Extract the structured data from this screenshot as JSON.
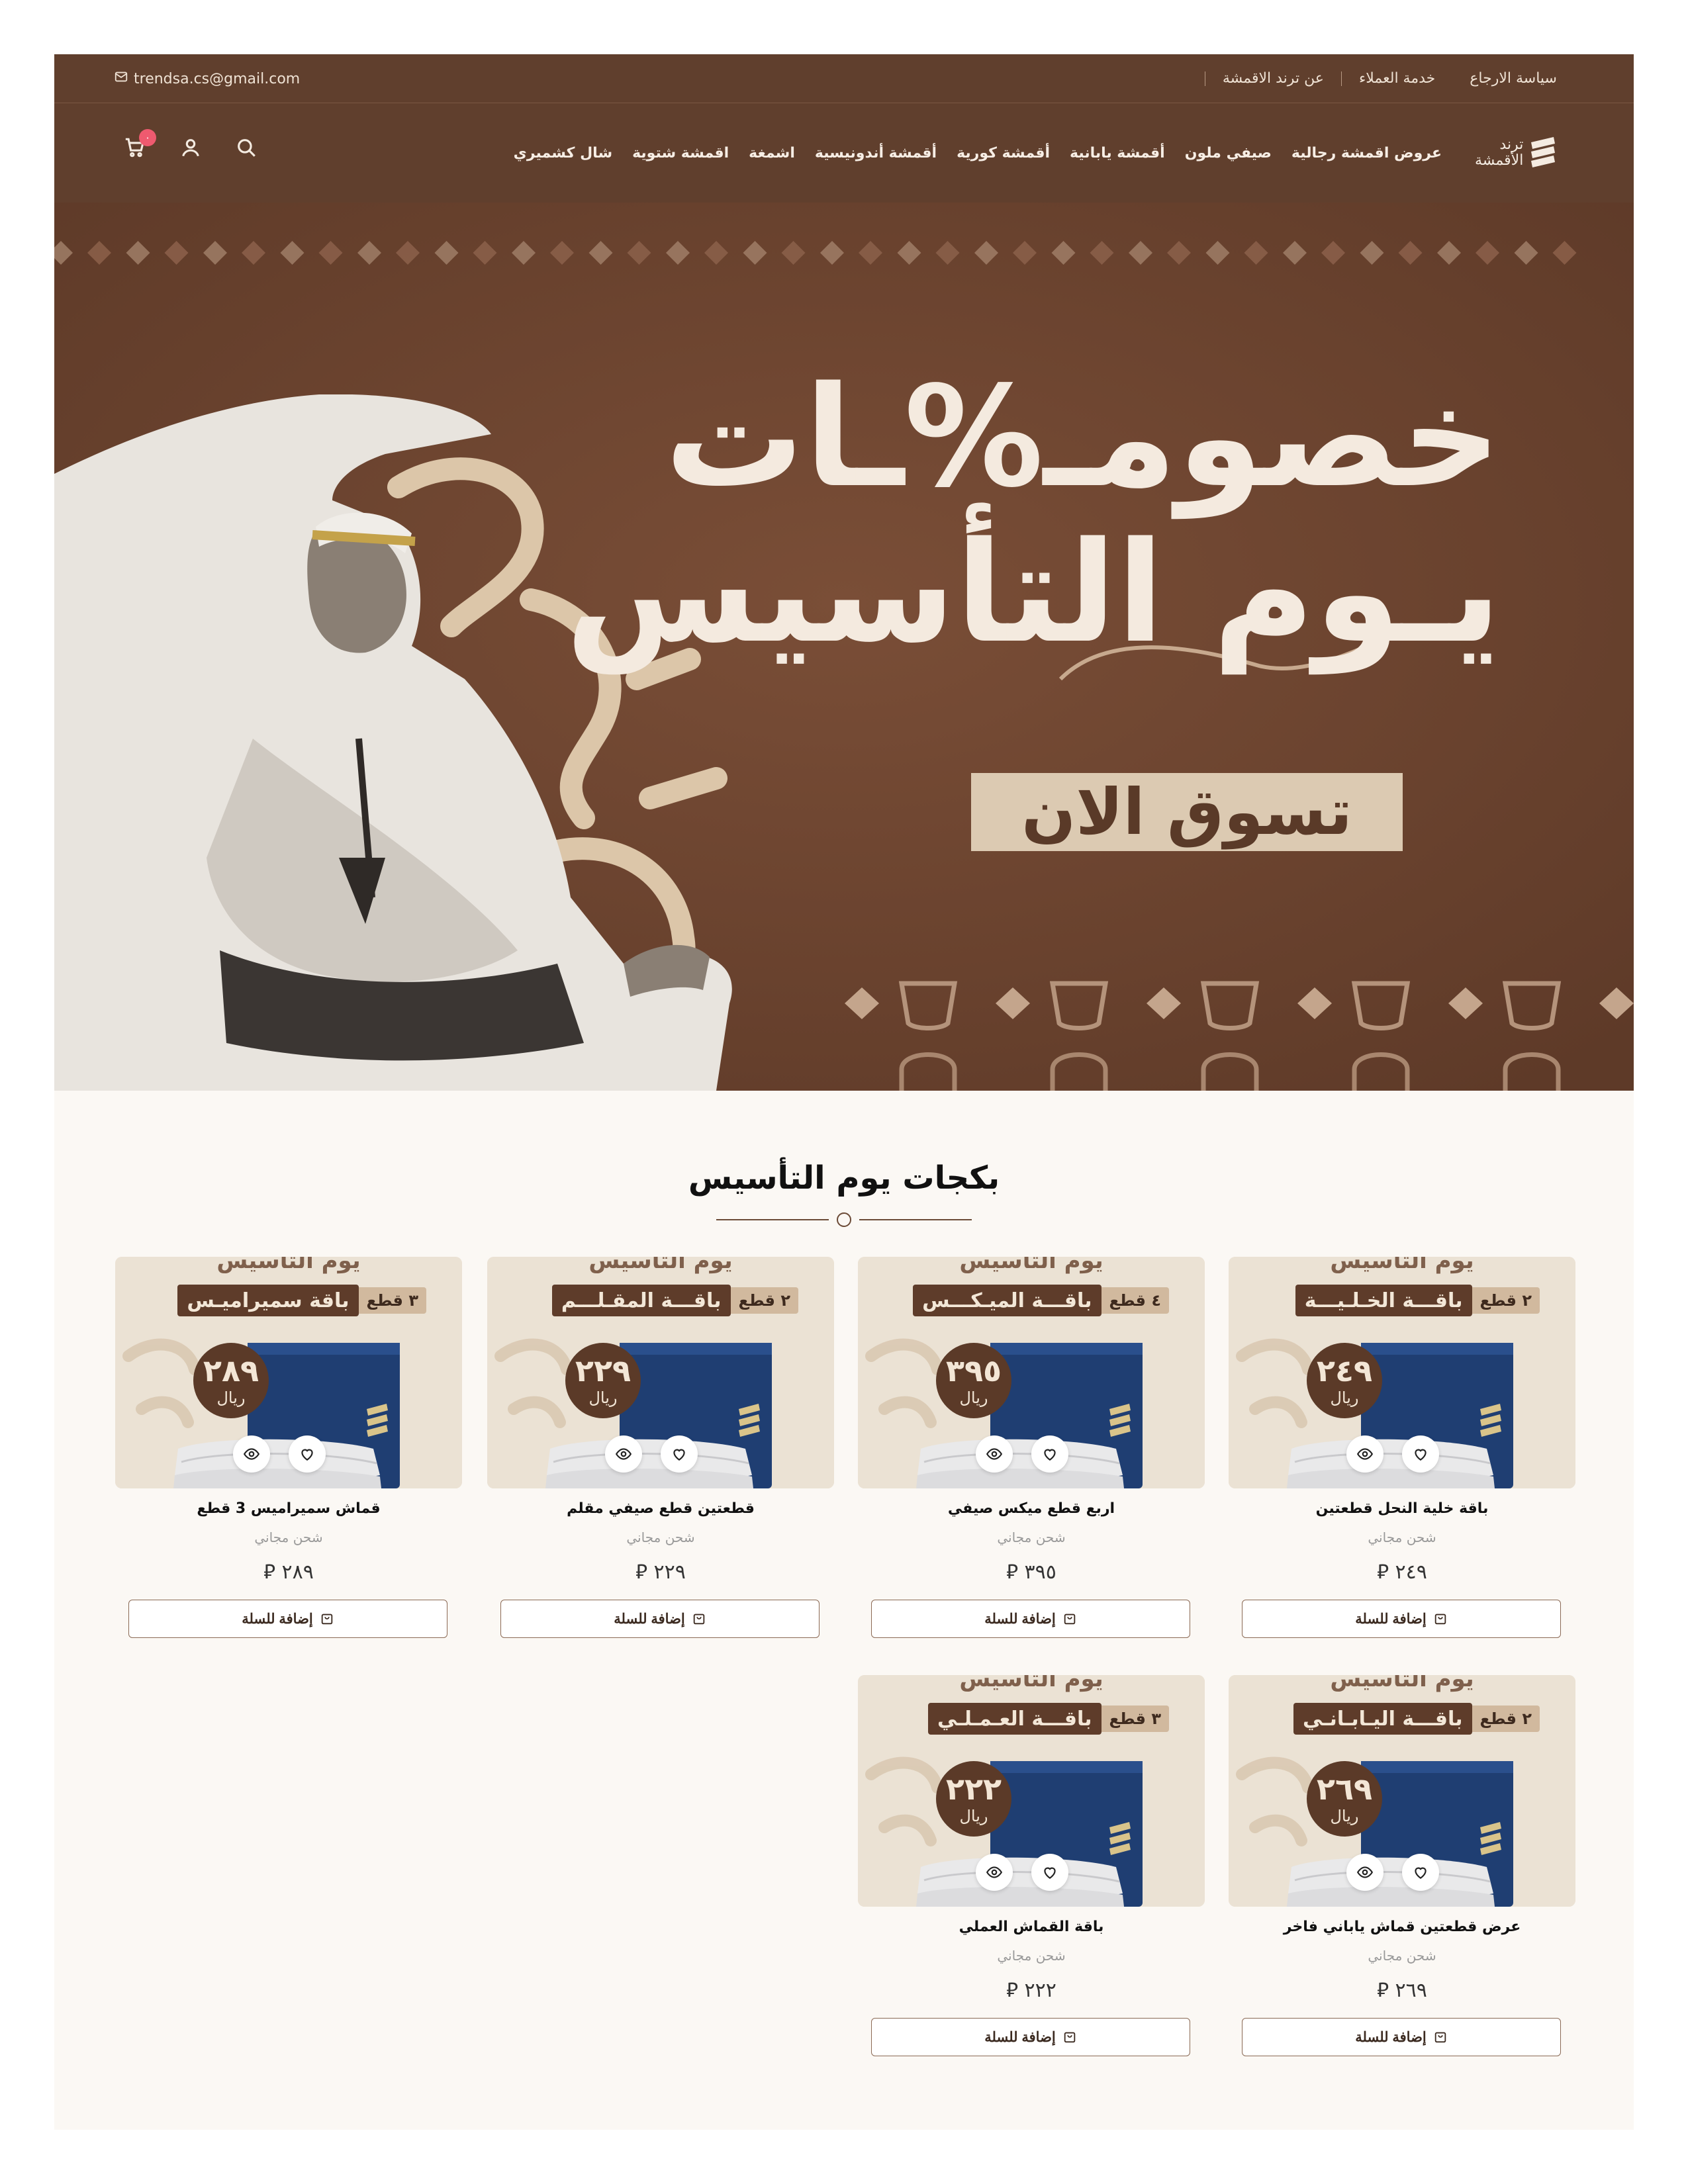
{
  "topbar": {
    "links": [
      "عن ترند الاقمشة",
      "خدمة العملاء",
      "سياسة الارجاع"
    ],
    "email": "trendsa.cs@gmail.com"
  },
  "header": {
    "logo_line1": "ترند",
    "logo_line2": "الأقمشة",
    "nav": [
      "عروض اقمشة رجالية",
      "صيفي ملون",
      "أقمشة يابانية",
      "أقمشة كورية",
      "أقمشة أندونيسية",
      "اشمغة",
      "اقمشة شتوية",
      "شال كشميري"
    ],
    "cart_count": "٠"
  },
  "hero": {
    "title_line1": "خصومـ%ـات",
    "title_line2": "يـوم التأسيس",
    "cta": "تسوق الان"
  },
  "section": {
    "title": "بكجات يوم التأسيس"
  },
  "common": {
    "shipping": "شحن مجاني",
    "add_to_cart": "إضافة للسلة",
    "image_heading": "يوم التأسيس",
    "currency": "ريال",
    "riyal_symbol": "⃁"
  },
  "products": [
    {
      "name": "باقة خلية النحل قطعتين",
      "price": "٢٤٩",
      "pkg": "باقـــة الخـلـيـــة",
      "count": "٢ قطع",
      "badge": "٢٤٩"
    },
    {
      "name": "اربع قطع ميكس صيفي",
      "price": "٣٩٥",
      "pkg": "باقـــة الميـكـــس",
      "count": "٤ قطع",
      "badge": "٣٩٥"
    },
    {
      "name": "قطعتين قطع صيفي مقلم",
      "price": "٢٢٩",
      "pkg": "باقـــة المقـلـــم",
      "count": "٢ قطع",
      "badge": "٢٢٩"
    },
    {
      "name": "قماش سميراميس 3 قطع",
      "price": "٢٨٩",
      "pkg": "باقة سميراميـس",
      "count": "٣ قطع",
      "badge": "٢٨٩"
    },
    {
      "name": "عرض قطعتين قماش ياباني فاخر",
      "price": "٢٦٩",
      "pkg": "باقـــة اليـابـانـي",
      "count": "٢ قطع",
      "badge": "٢٦٩"
    },
    {
      "name": "باقة القماش العملي",
      "price": "٢٢٢",
      "pkg": "باقـــة العـمـلـي",
      "count": "٣ قطع",
      "badge": "٢٢٢"
    }
  ],
  "icons": [
    "mail-icon",
    "search-icon",
    "user-icon",
    "cart-icon",
    "heart-icon",
    "eye-icon",
    "cart-add-icon"
  ],
  "colors": {
    "brand_brown": "#603f2d",
    "hero_brown": "#6c4430",
    "beige": "#dccab2",
    "badge_red": "#ef5a6f",
    "page_bg": "#fbf8f4"
  }
}
